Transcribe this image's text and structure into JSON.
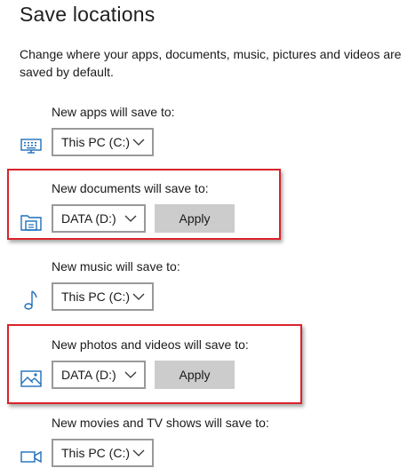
{
  "page": {
    "title": "Save locations",
    "description": "Change where your apps, documents, music, pictures and videos are saved by default."
  },
  "settings": [
    {
      "label": "New apps will save to:",
      "icon": "monitor-icon",
      "selected": "This PC (C:)",
      "apply_label": null
    },
    {
      "label": "New documents will save to:",
      "icon": "documents-folder-icon",
      "selected": "DATA (D:)",
      "apply_label": "Apply"
    },
    {
      "label": "New music will save to:",
      "icon": "music-note-icon",
      "selected": "This PC (C:)",
      "apply_label": null
    },
    {
      "label": "New photos and videos will save to:",
      "icon": "picture-icon",
      "selected": "DATA (D:)",
      "apply_label": "Apply"
    },
    {
      "label": "New movies and TV shows will save to:",
      "icon": "video-camera-icon",
      "selected": "This PC (C:)",
      "apply_label": null
    }
  ],
  "colors": {
    "highlight_border": "#d9232a",
    "icon_accent": "#1e6fb8",
    "apply_button_bg": "#cccccc"
  }
}
